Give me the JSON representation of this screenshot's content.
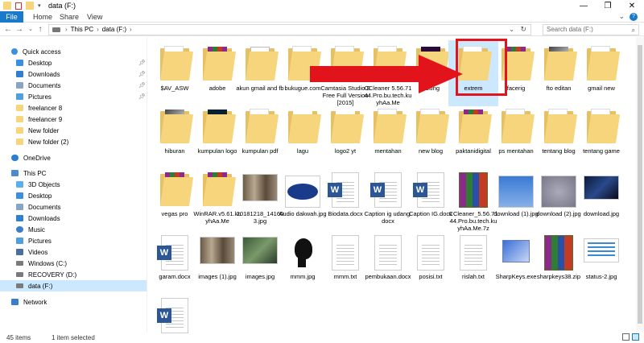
{
  "window": {
    "title": "data (F:)",
    "minimize": "—",
    "maximize": "❐",
    "close": "✕"
  },
  "ribbon": {
    "tabs": [
      "File",
      "Home",
      "Share",
      "View"
    ],
    "help": "?"
  },
  "address": {
    "crumbs": [
      "This PC",
      "data (F:)"
    ],
    "separator": "›",
    "search_placeholder": "Search data (F:)"
  },
  "nav": {
    "quick_access": "Quick access",
    "quick_items": [
      {
        "label": "Desktop",
        "pinned": true
      },
      {
        "label": "Downloads",
        "pinned": true
      },
      {
        "label": "Documents",
        "pinned": true
      },
      {
        "label": "Pictures",
        "pinned": true
      },
      {
        "label": "freelancer 8",
        "pinned": false
      },
      {
        "label": "freelancer 9",
        "pinned": false
      },
      {
        "label": "New folder",
        "pinned": false
      },
      {
        "label": "New folder (2)",
        "pinned": false
      }
    ],
    "onedrive": "OneDrive",
    "this_pc": "This PC",
    "pc_items": [
      "3D Objects",
      "Desktop",
      "Documents",
      "Downloads",
      "Music",
      "Pictures",
      "Videos",
      "Windows (C:)",
      "RECOVERY (D:)",
      "data (F:)"
    ],
    "network": "Network"
  },
  "files": [
    {
      "name": "$AV_ASW",
      "type": "folder"
    },
    {
      "name": "adobe",
      "type": "folder-rar"
    },
    {
      "name": "akun gmail and fb",
      "type": "folder-sheet"
    },
    {
      "name": "bukugue.com",
      "type": "folder"
    },
    {
      "name": "Camtasia Studio 8 Free Full Version [2015]",
      "type": "folder"
    },
    {
      "name": "CCleaner 5.56.7144.Pro.bu.tech.kuyhAa.Me",
      "type": "folder"
    },
    {
      "name": "editing",
      "type": "folder-pr"
    },
    {
      "name": "extrem",
      "type": "folder-selected"
    },
    {
      "name": "facerig",
      "type": "folder-rar"
    },
    {
      "name": "fto editan",
      "type": "folder-photo"
    },
    {
      "name": "gmail new",
      "type": "folder"
    },
    {
      "name": "hiburan",
      "type": "folder-photo"
    },
    {
      "name": "kumpulan logo",
      "type": "folder-dark"
    },
    {
      "name": "kumpulan pdf",
      "type": "folder"
    },
    {
      "name": "lagu",
      "type": "folder-blue"
    },
    {
      "name": "logo2 yt",
      "type": "folder-bw"
    },
    {
      "name": "mentahan",
      "type": "folder"
    },
    {
      "name": "new blog",
      "type": "folder"
    },
    {
      "name": "paktanidigital",
      "type": "folder-rar"
    },
    {
      "name": "ps mentahan",
      "type": "folder"
    },
    {
      "name": "tentang blog",
      "type": "folder"
    },
    {
      "name": "tentang game",
      "type": "folder"
    },
    {
      "name": "vegas pro",
      "type": "folder-rar"
    },
    {
      "name": "WinRAR.v5.61.kuyhAa.Me",
      "type": "folder-rar"
    },
    {
      "name": "20181218_141603.jpg",
      "type": "image-wide"
    },
    {
      "name": "Audio dakwah.jpg",
      "type": "image-logo"
    },
    {
      "name": "Biodata.docx",
      "type": "word"
    },
    {
      "name": "Caption ig udang.docx",
      "type": "word"
    },
    {
      "name": "Caption IG.docx",
      "type": "word"
    },
    {
      "name": "CCleaner_5.56.7144.Pro.bu.tech.kuyhAa.Me.7z",
      "type": "rar"
    },
    {
      "name": "download (1).jpg",
      "type": "image-blue"
    },
    {
      "name": "download (2).jpg",
      "type": "image-gray"
    },
    {
      "name": "download.jpg",
      "type": "image-dark"
    },
    {
      "name": "garam.docx",
      "type": "word"
    },
    {
      "name": "images (1).jpg",
      "type": "image-wide"
    },
    {
      "name": "images.jpg",
      "type": "image-green"
    },
    {
      "name": "mmm.jpg",
      "type": "image-silhouette"
    },
    {
      "name": "mmm.txt",
      "type": "text"
    },
    {
      "name": "pembukaan.docx",
      "type": "text"
    },
    {
      "name": "posisi.txt",
      "type": "text"
    },
    {
      "name": "rislah.txt",
      "type": "text"
    },
    {
      "name": "SharpKeys.exe",
      "type": "exe"
    },
    {
      "name": "sharpkeys38.zip",
      "type": "rar"
    },
    {
      "name": "status-2.jpg",
      "type": "image-screen"
    },
    {
      "name": "",
      "type": "word"
    }
  ],
  "status": {
    "count": "45 items",
    "selected": "1 item selected"
  },
  "colors": {
    "accent": "#1979ca",
    "selection": "#cce8ff",
    "highlight_border": "#e3131b",
    "folder": "#f6d57c"
  }
}
